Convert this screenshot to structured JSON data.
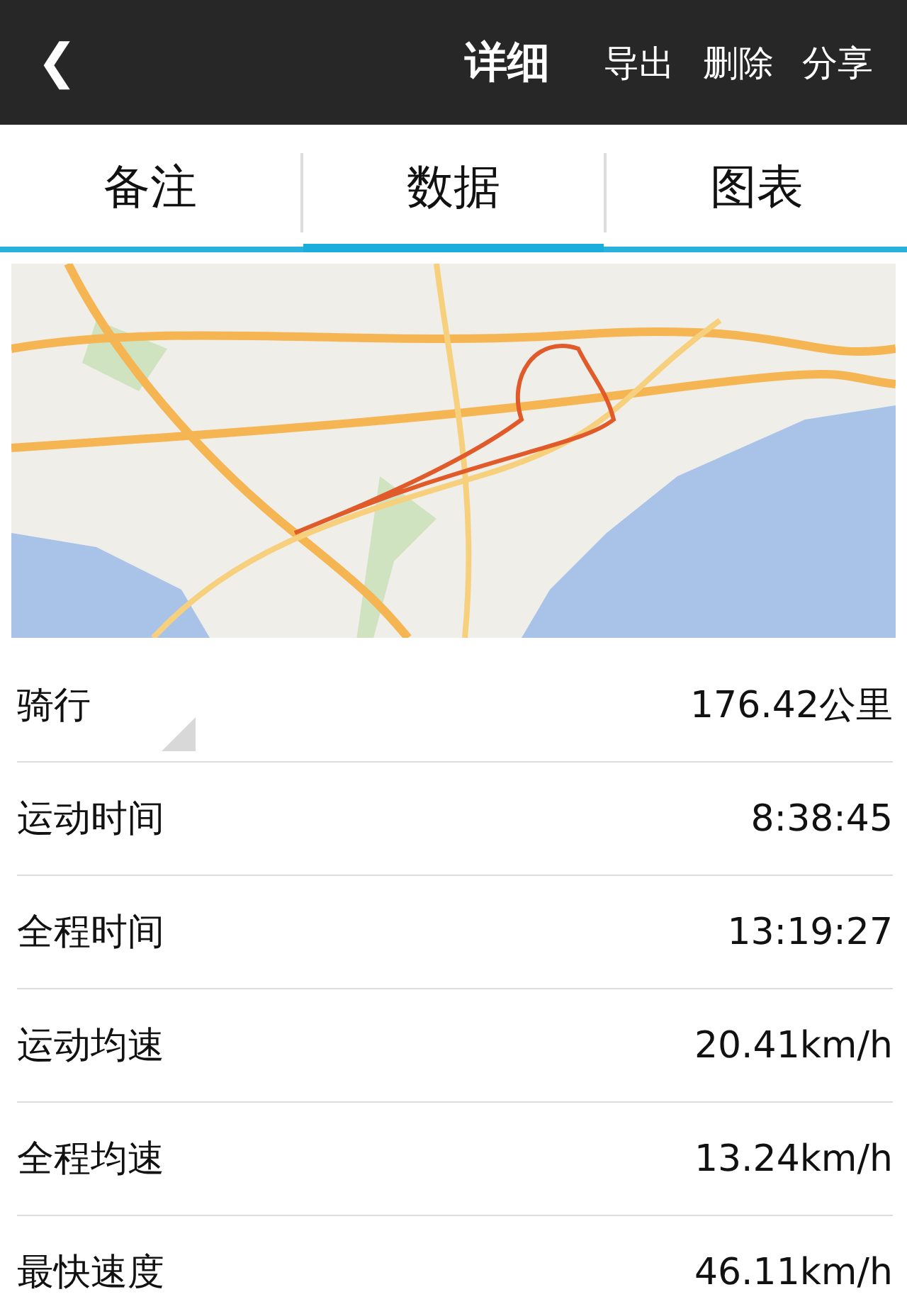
{
  "nav_bar": {
    "back": "❮",
    "title": "详细",
    "actions": [
      "导出",
      "删除",
      "分享"
    ]
  },
  "tabs": [
    {
      "label": "备注",
      "selected": false
    },
    {
      "label": "数据",
      "selected": true
    },
    {
      "label": "图表",
      "selected": false
    }
  ],
  "stats": [
    {
      "kind": "dropdown",
      "label": "骑行",
      "value": "176.42公里"
    },
    {
      "kind": "plain",
      "label": "运动时间",
      "value": "8:38:45"
    },
    {
      "kind": "plain",
      "label": "全程时间",
      "value": "13:19:27"
    },
    {
      "kind": "plain",
      "label": "运动均速",
      "value": "20.41km/h"
    },
    {
      "kind": "plain",
      "label": "全程均速",
      "value": "13.24km/h"
    },
    {
      "kind": "plain",
      "label": "最快速度",
      "value": "46.11km/h"
    }
  ]
}
